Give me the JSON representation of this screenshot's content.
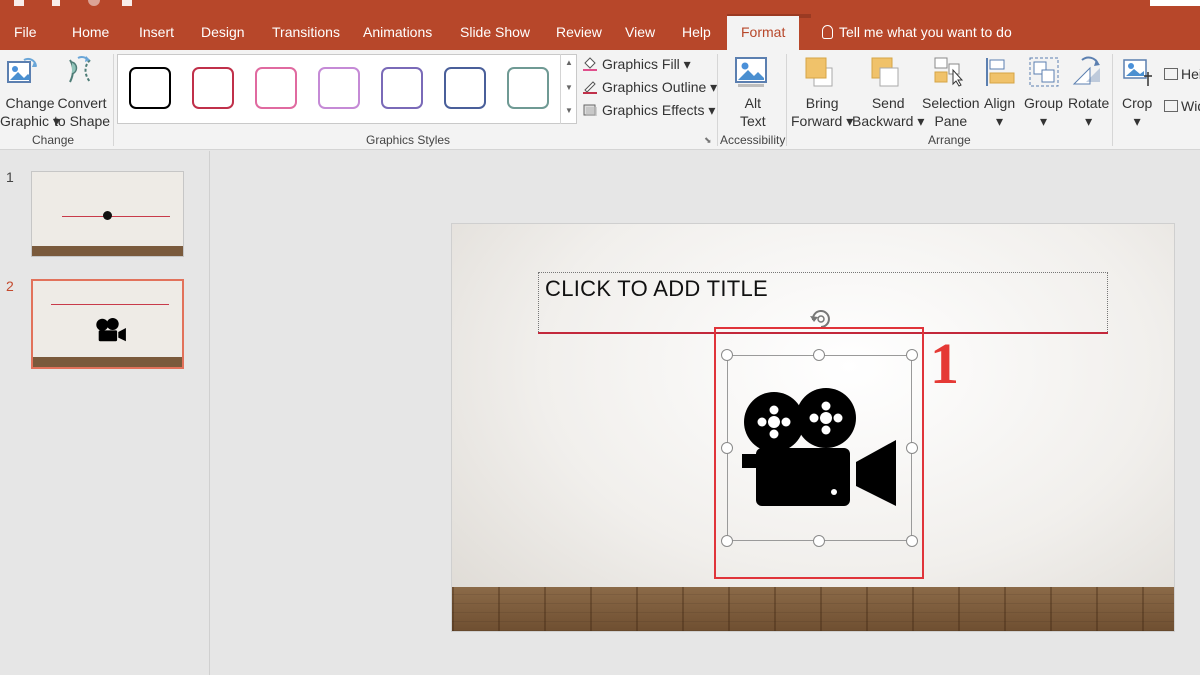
{
  "tabs": [
    {
      "label": "File"
    },
    {
      "label": "Home"
    },
    {
      "label": "Insert"
    },
    {
      "label": "Design"
    },
    {
      "label": "Transitions"
    },
    {
      "label": "Animations"
    },
    {
      "label": "Slide Show"
    },
    {
      "label": "Review"
    },
    {
      "label": "View"
    },
    {
      "label": "Help"
    },
    {
      "label": "Format"
    }
  ],
  "active_tab": "Format",
  "tell_me": "Tell me what you want to do",
  "ribbon": {
    "change": {
      "change_graphic_1": "Change",
      "change_graphic_2": "Graphic",
      "convert_1": "Convert",
      "convert_2": "to Shape",
      "label": "Change"
    },
    "graphics_styles": {
      "label": "Graphics Styles",
      "swatch_colors": [
        "#000000",
        "#c0304a",
        "#e06aa0",
        "#c58ad6",
        "#7a6ab8",
        "#4a5f9a",
        "#6f9a94"
      ],
      "fill": "Graphics Fill",
      "outline": "Graphics Outline",
      "effects": "Graphics Effects"
    },
    "accessibility": {
      "alt_1": "Alt",
      "alt_2": "Text",
      "label": "Accessibility"
    },
    "arrange": {
      "bring_1": "Bring",
      "bring_2": "Forward",
      "send_1": "Send",
      "send_2": "Backward",
      "selection_1": "Selection",
      "selection_2": "Pane",
      "align": "Align",
      "group": "Group",
      "rotate": "Rotate",
      "label": "Arrange"
    },
    "size": {
      "crop": "Crop",
      "height": "Hei",
      "width": "Wid"
    }
  },
  "thumbnails": [
    {
      "number": "1"
    },
    {
      "number": "2"
    }
  ],
  "slide": {
    "title_placeholder": "CLICK TO ADD TITLE"
  },
  "annotation": {
    "step": "1"
  },
  "colors": {
    "accent": "#b7472a",
    "highlight": "#e0343a"
  }
}
